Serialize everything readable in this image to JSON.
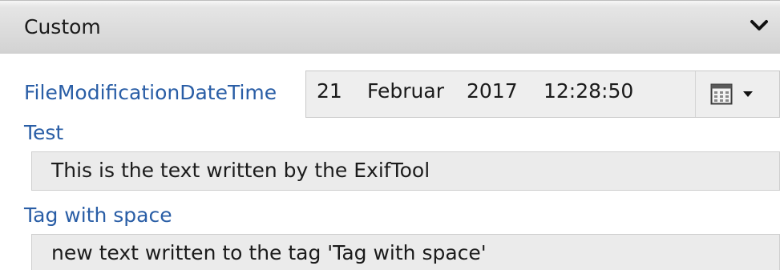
{
  "section": {
    "title": "Custom",
    "collapse_icon": "chevron-down-icon"
  },
  "fields": {
    "file_modification": {
      "label": "FileModificationDateTime",
      "day": "21",
      "month": "Februar",
      "year": "2017",
      "time": "12:28:50",
      "picker_icon": "calendar-icon",
      "dropdown_icon": "caret-down-icon"
    },
    "test": {
      "label": "Test",
      "value": "This is the text written by the ExifTool"
    },
    "tag_with_space": {
      "label": "Tag with space",
      "value": "new text written to the tag 'Tag with space'"
    }
  }
}
